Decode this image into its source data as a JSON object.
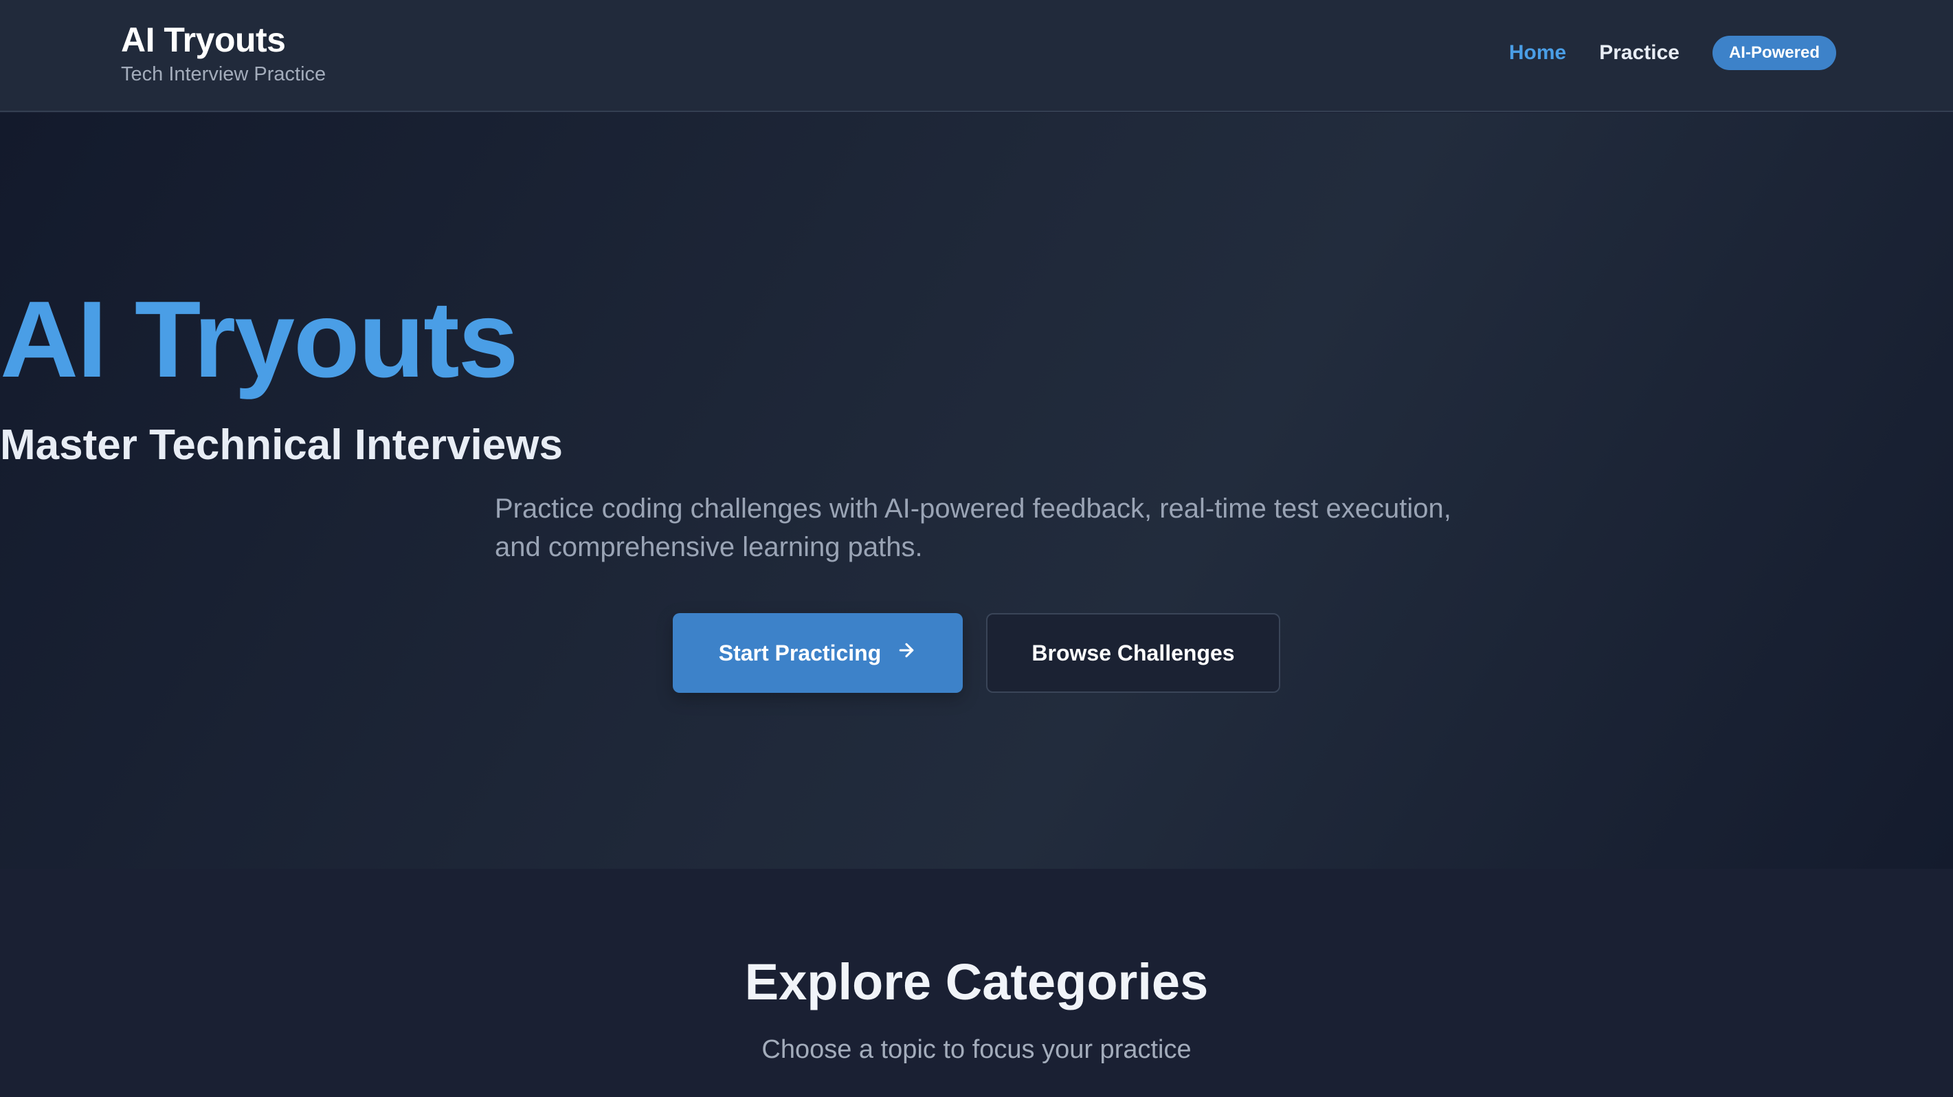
{
  "header": {
    "brand_title": "AI Tryouts",
    "brand_subtitle": "Tech Interview Practice",
    "nav": {
      "home": "Home",
      "practice": "Practice",
      "badge": "AI-Powered"
    }
  },
  "hero": {
    "title": "AI Tryouts",
    "subtitle": "Master Technical Interviews",
    "description": "Practice coding challenges with AI-powered feedback, real-time test execution, and comprehensive learning paths.",
    "primary_button": "Start Practicing",
    "primary_button_icon": "arrow-right-icon",
    "secondary_button": "Browse Challenges"
  },
  "categories": {
    "title": "Explore Categories",
    "subtitle": "Choose a topic to focus your practice"
  },
  "colors": {
    "accent": "#4a9ee6",
    "button_primary": "#3d82c9",
    "background": "#1a2033",
    "header": "#212a3b"
  }
}
